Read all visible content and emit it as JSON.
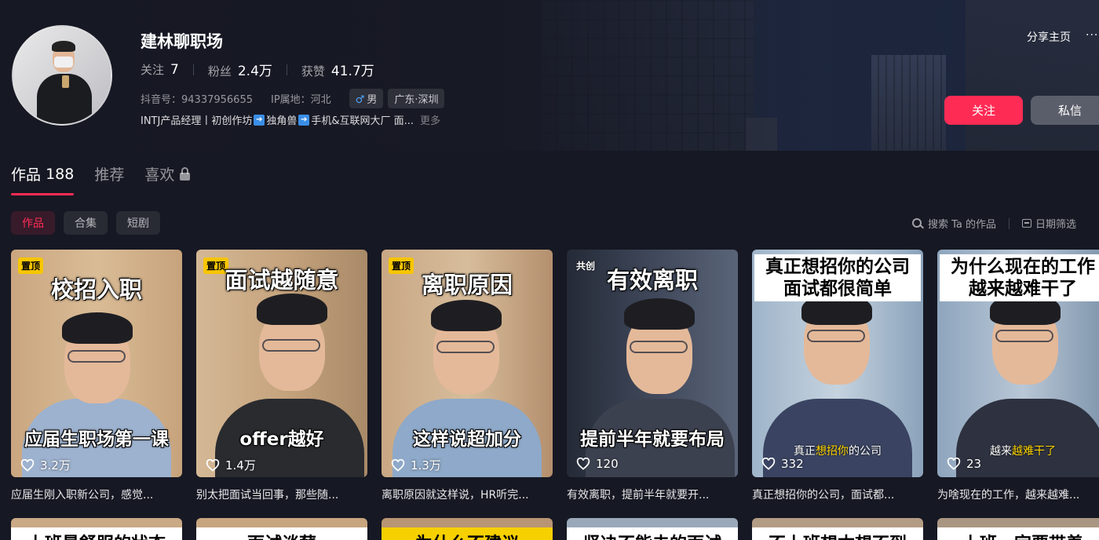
{
  "profile": {
    "name": "建林聊职场",
    "following_label": "关注",
    "following": "7",
    "followers_label": "粉丝",
    "followers": "2.4万",
    "likes_label": "获赞",
    "likes": "41.7万",
    "douyin_id": "抖音号：94337956655",
    "ip": "IP属地：河北",
    "gender": "男",
    "gender_icon": "♂",
    "location": "广东·深圳",
    "bio_a": "INTJ产品经理丨初创作坊",
    "bio_b": "独角兽",
    "bio_c": "手机&互联网大厂  面...",
    "more": "更多",
    "share": "分享主页",
    "dots": "···",
    "follow_btn": "关注",
    "message_btn": "私信"
  },
  "tabs": {
    "works_label": "作品",
    "works_count": "188",
    "recommend": "推荐",
    "likes": "喜欢"
  },
  "subtabs": [
    "作品",
    "合集",
    "短剧"
  ],
  "tools": {
    "search": "搜索 Ta 的作品",
    "date_filter": "日期筛选"
  },
  "videos": [
    {
      "badge": "置顶",
      "title": "校招入职",
      "caption": "应届生职场第一课",
      "likes": "3.2万",
      "desc": "应届生刚入职新公司，感觉..."
    },
    {
      "badge": "置顶",
      "title": "面试越随意",
      "caption": "offer越好",
      "likes": "1.4万",
      "desc": "别太把面试当回事，那些随..."
    },
    {
      "badge": "置顶",
      "title": "离职原因",
      "caption": "这样说超加分",
      "likes": "1.3万",
      "desc": "离职原因就这样说，HR听完..."
    },
    {
      "badge": "共创",
      "title": "有效离职",
      "caption": "提前半年就要布局",
      "likes": "120",
      "desc": "有效离职，提前半年就要开..."
    },
    {
      "title_line1": "真正想招你的公司",
      "title_line2": "面试都很简单",
      "sub_a": "真正",
      "sub_hl": "想招你",
      "sub_b": "的公司",
      "likes": "332",
      "desc": "真正想招你的公司，面试都..."
    },
    {
      "title_line1": "为什么现在的工作",
      "title_line2": "越来越难干了",
      "sub_a": "越来",
      "sub_hl": "越难干了",
      "sub_b": "",
      "likes": "23",
      "desc": "为啥现在的工作，越来越难..."
    }
  ],
  "row2": [
    "上班最舒服的状态",
    "面试谈薪",
    "为什么不建议",
    "坚决不能去的面试",
    "不上班想本想不到",
    "上班一定要带着"
  ],
  "colors": {
    "accent": "#fe2c55",
    "bg": "#161823",
    "pin": "#f7c600"
  }
}
